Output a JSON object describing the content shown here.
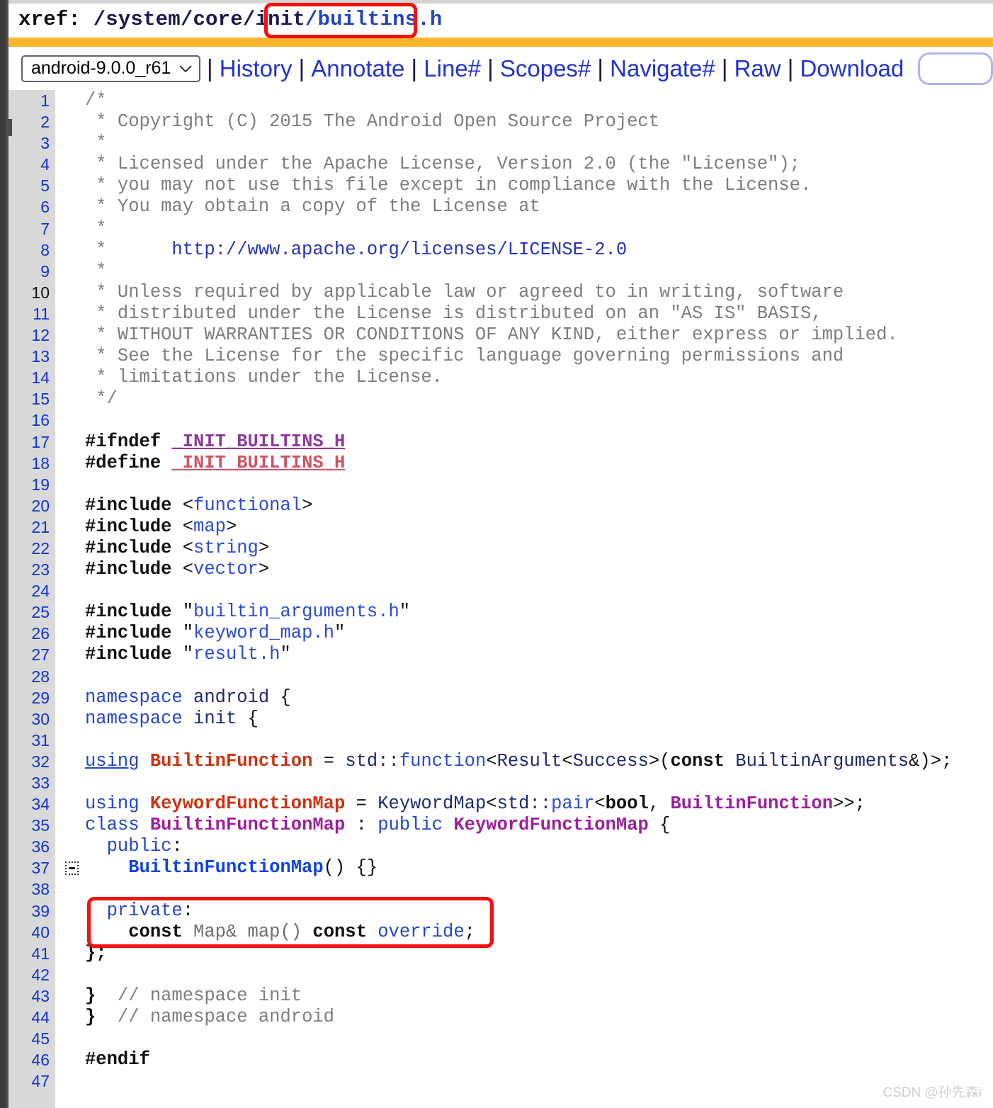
{
  "header": {
    "xref_label": "xref: ",
    "path_dir": "/system/core/init",
    "path_file": "/builtins.h"
  },
  "toolbar": {
    "version_selected": "android-9.0.0_r61",
    "separator": "|",
    "links": [
      "History",
      "Annotate",
      "Line#",
      "Scopes#",
      "Navigate#",
      "Raw",
      "Download"
    ],
    "search_value": ""
  },
  "colors": {
    "accent_bar": "#fdb52d",
    "annotation": "#f40f0f",
    "gutter": "#d9d9d9",
    "link": "#2233cc"
  },
  "annotations": [
    {
      "name": "builtins-file-highlight",
      "target": "/builtins.h"
    },
    {
      "name": "private-map-highlight",
      "target": "private: const Map& map() const override;"
    }
  ],
  "code": {
    "language": "cpp",
    "first_line": 1,
    "last_line": 47,
    "visited_line_numbers": [
      10
    ],
    "fold_marker_line": 37,
    "lines": [
      {
        "n": 1,
        "text": "/*"
      },
      {
        "n": 2,
        "text": " * Copyright (C) 2015 The Android Open Source Project"
      },
      {
        "n": 3,
        "text": " *"
      },
      {
        "n": 4,
        "text": " * Licensed under the Apache License, Version 2.0 (the \"License\");"
      },
      {
        "n": 5,
        "text": " * you may not use this file except in compliance with the License."
      },
      {
        "n": 6,
        "text": " * You may obtain a copy of the License at"
      },
      {
        "n": 7,
        "text": " *"
      },
      {
        "n": 8,
        "text": " *      http://www.apache.org/licenses/LICENSE-2.0"
      },
      {
        "n": 9,
        "text": " *"
      },
      {
        "n": 10,
        "text": " * Unless required by applicable law or agreed to in writing, software"
      },
      {
        "n": 11,
        "text": " * distributed under the License is distributed on an \"AS IS\" BASIS,"
      },
      {
        "n": 12,
        "text": " * WITHOUT WARRANTIES OR CONDITIONS OF ANY KIND, either express or implied."
      },
      {
        "n": 13,
        "text": " * See the License for the specific language governing permissions and"
      },
      {
        "n": 14,
        "text": " * limitations under the License."
      },
      {
        "n": 15,
        "text": " */"
      },
      {
        "n": 16,
        "text": ""
      },
      {
        "n": 17,
        "text": "#ifndef _INIT_BUILTINS_H"
      },
      {
        "n": 18,
        "text": "#define _INIT_BUILTINS_H"
      },
      {
        "n": 19,
        "text": ""
      },
      {
        "n": 20,
        "text": "#include <functional>"
      },
      {
        "n": 21,
        "text": "#include <map>"
      },
      {
        "n": 22,
        "text": "#include <string>"
      },
      {
        "n": 23,
        "text": "#include <vector>"
      },
      {
        "n": 24,
        "text": ""
      },
      {
        "n": 25,
        "text": "#include \"builtin_arguments.h\""
      },
      {
        "n": 26,
        "text": "#include \"keyword_map.h\""
      },
      {
        "n": 27,
        "text": "#include \"result.h\""
      },
      {
        "n": 28,
        "text": ""
      },
      {
        "n": 29,
        "text": "namespace android {"
      },
      {
        "n": 30,
        "text": "namespace init {"
      },
      {
        "n": 31,
        "text": ""
      },
      {
        "n": 32,
        "text": "using BuiltinFunction = std::function<Result<Success>(const BuiltinArguments&)>;"
      },
      {
        "n": 33,
        "text": ""
      },
      {
        "n": 34,
        "text": "using KeywordFunctionMap = KeywordMap<std::pair<bool, BuiltinFunction>>;"
      },
      {
        "n": 35,
        "text": "class BuiltinFunctionMap : public KeywordFunctionMap {"
      },
      {
        "n": 36,
        "text": "  public:"
      },
      {
        "n": 37,
        "text": "    BuiltinFunctionMap() {}"
      },
      {
        "n": 38,
        "text": ""
      },
      {
        "n": 39,
        "text": "  private:"
      },
      {
        "n": 40,
        "text": "    const Map& map() const override;"
      },
      {
        "n": 41,
        "text": "};"
      },
      {
        "n": 42,
        "text": ""
      },
      {
        "n": 43,
        "text": "}  // namespace init"
      },
      {
        "n": 44,
        "text": "}  // namespace android"
      },
      {
        "n": 45,
        "text": ""
      },
      {
        "n": 46,
        "text": "#endif"
      },
      {
        "n": 47,
        "text": ""
      }
    ]
  },
  "watermark": "CSDN @孙先森i"
}
